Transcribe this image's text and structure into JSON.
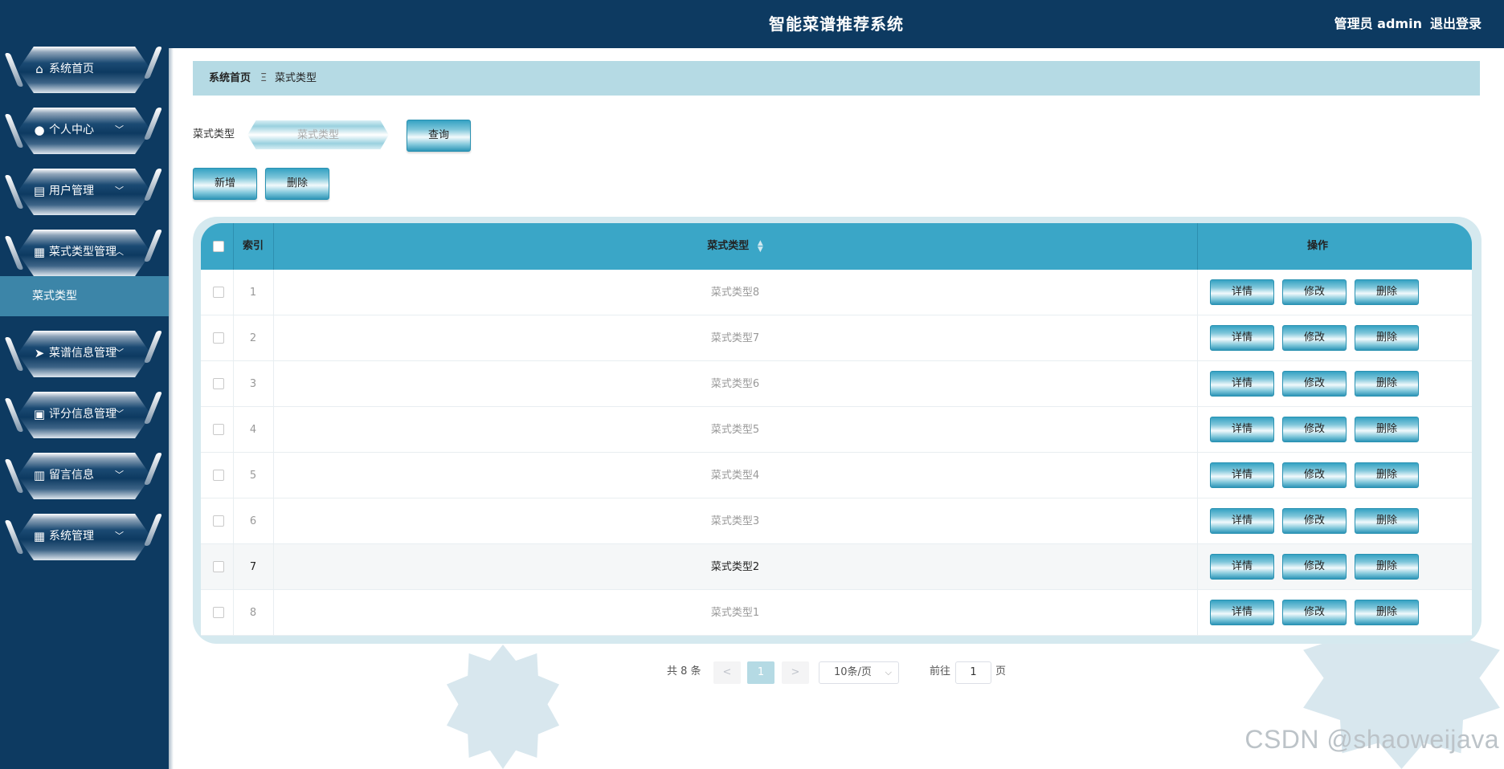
{
  "header": {
    "title": "智能菜谱推荐系统",
    "user": "管理员 admin",
    "logout": "退出登录"
  },
  "sidebar": {
    "items": [
      {
        "label": "系统首页",
        "icon": "home-icon",
        "glyph": "⌂"
      },
      {
        "label": "个人中心",
        "icon": "user-icon",
        "glyph": "●"
      },
      {
        "label": "用户管理",
        "icon": "chat-icon",
        "glyph": "▤"
      },
      {
        "label": "菜式类型管理",
        "icon": "grid-icon",
        "glyph": "▦"
      },
      {
        "label": "菜谱信息管理",
        "icon": "send-icon",
        "glyph": "➤"
      },
      {
        "label": "评分信息管理",
        "icon": "briefcase-icon",
        "glyph": "▣"
      },
      {
        "label": "留言信息",
        "icon": "clipboard-icon",
        "glyph": "▥"
      },
      {
        "label": "系统管理",
        "icon": "grid-icon",
        "glyph": "▦"
      }
    ],
    "submenu": {
      "label": "菜式类型"
    }
  },
  "breadcrumb": {
    "home": "系统首页",
    "sep": "Ξ",
    "current": "菜式类型"
  },
  "search": {
    "label": "菜式类型",
    "placeholder": "菜式类型",
    "query_label": "查询"
  },
  "toolbar": {
    "add_label": "新增",
    "delete_label": "删除"
  },
  "table": {
    "headers": {
      "index": "索引",
      "type": "菜式类型",
      "actions": "操作"
    },
    "rows": [
      {
        "index": "1",
        "type": "菜式类型8"
      },
      {
        "index": "2",
        "type": "菜式类型7"
      },
      {
        "index": "3",
        "type": "菜式类型6"
      },
      {
        "index": "4",
        "type": "菜式类型5"
      },
      {
        "index": "5",
        "type": "菜式类型4"
      },
      {
        "index": "6",
        "type": "菜式类型3"
      },
      {
        "index": "7",
        "type": "菜式类型2"
      },
      {
        "index": "8",
        "type": "菜式类型1"
      }
    ],
    "row_actions": {
      "detail": "详情",
      "edit": "修改",
      "delete": "删除"
    }
  },
  "pagination": {
    "total": "共 8 条",
    "prev": "<",
    "page": "1",
    "next": ">",
    "page_size": "10条/页",
    "goto_label": "前往",
    "goto_value": "1",
    "page_suffix": "页"
  },
  "watermark": "CSDN @shaoweijava",
  "colors": {
    "primary_dark": "#0d3a61",
    "accent": "#3aa6c7",
    "breadcrumb_bg": "#b5dae4"
  }
}
